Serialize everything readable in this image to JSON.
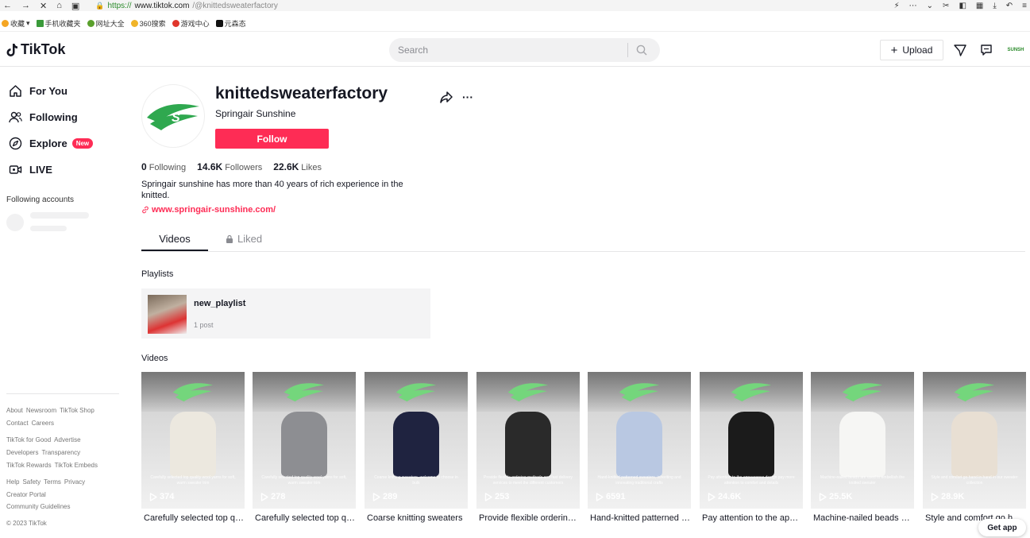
{
  "browser": {
    "url_proto": "https://",
    "url_host": "www.tiktok.com",
    "url_path": "/@knittedsweaterfactory",
    "bookmarks": [
      "收藏",
      "手机收藏夹",
      "网址大全",
      "360搜索",
      "游戏中心",
      "元森态"
    ]
  },
  "header": {
    "logo_text": "TikTok",
    "search_placeholder": "Search",
    "upload_label": "Upload",
    "avatar_text": "SUNSH"
  },
  "sidebar": {
    "items": [
      {
        "label": "For You",
        "icon": "home-icon"
      },
      {
        "label": "Following",
        "icon": "people-icon"
      },
      {
        "label": "Explore",
        "icon": "compass-icon",
        "badge": "New"
      },
      {
        "label": "LIVE",
        "icon": "live-icon"
      }
    ],
    "following_accounts_label": "Following accounts",
    "footer": [
      [
        "About",
        "Newsroom",
        "TikTok Shop"
      ],
      [
        "Contact",
        "Careers"
      ],
      [
        "TikTok for Good",
        "Advertise"
      ],
      [
        "Developers",
        "Transparency"
      ],
      [
        "TikTok Rewards",
        "TikTok Embeds"
      ],
      [
        "Help",
        "Safety",
        "Terms",
        "Privacy"
      ],
      [
        "Creator Portal"
      ],
      [
        "Community Guidelines"
      ],
      [
        "© 2023 TikTok"
      ]
    ]
  },
  "profile": {
    "username": "knittedsweaterfactory",
    "nickname": "Springair Sunshine",
    "follow_label": "Follow",
    "stats": [
      {
        "value": "0",
        "label": "Following"
      },
      {
        "value": "14.6K",
        "label": "Followers"
      },
      {
        "value": "22.6K",
        "label": "Likes"
      }
    ],
    "bio": "Springair sunshine has more than 40 years of rich experience in the knitted.",
    "link": "www.springair-sunshine.com/"
  },
  "tabs": {
    "videos": "Videos",
    "liked": "Liked"
  },
  "playlists": {
    "title": "Playlists",
    "name": "new_playlist",
    "count": "1 post"
  },
  "videos_title": "Videos",
  "videos": [
    {
      "views": "374",
      "title": "Carefully selected top quality wool yarns",
      "garment": "#ece8df",
      "caption": "Carefully selected top quality wool yarns for soft, warm sweater trim"
    },
    {
      "views": "278",
      "title": "Carefully selected top quality wool yarns",
      "garment": "#8d8e92",
      "caption": "Carefully selected top quality wool yarns for soft, warm sweater trim"
    },
    {
      "views": "289",
      "title": "Coarse knitting sweaters",
      "garment": "#1f2340",
      "caption": "Coarse knitting sweaters, welcome to choose in bulk"
    },
    {
      "views": "253",
      "title": "Provide flexible ordering methods",
      "garment": "#2a2a2a",
      "caption": "Provide flexible ordering methods and fast delivery services to meet the different customers"
    },
    {
      "views": "6591",
      "title": "Hand-knitted patterned sweaters",
      "garment": "#b9c8e2",
      "caption": "Hand-knitted patterned sweaters, inheriting and innovating traditional crafts"
    },
    {
      "views": "24.6K",
      "title": "Pay attention to the appearance design",
      "garment": "#1b1b1b",
      "caption": "Pay attention to the appearance design pay more attention to comfort and details"
    },
    {
      "views": "25.5K",
      "title": "Machine-nailed beads are used to embellish",
      "garment": "#f6f6f4",
      "caption": "Machine-nailed beads are used to embellish the knitted sweater"
    },
    {
      "views": "28.9K",
      "title": "Style and comfort go hand in hand",
      "garment": "#e8dfd3",
      "caption": "Style and comfort go hand in hand in our sweater collection"
    }
  ],
  "get_app_label": "Get app",
  "colors": {
    "accent": "#fe2c55",
    "brand_green": "#2fa84f"
  }
}
